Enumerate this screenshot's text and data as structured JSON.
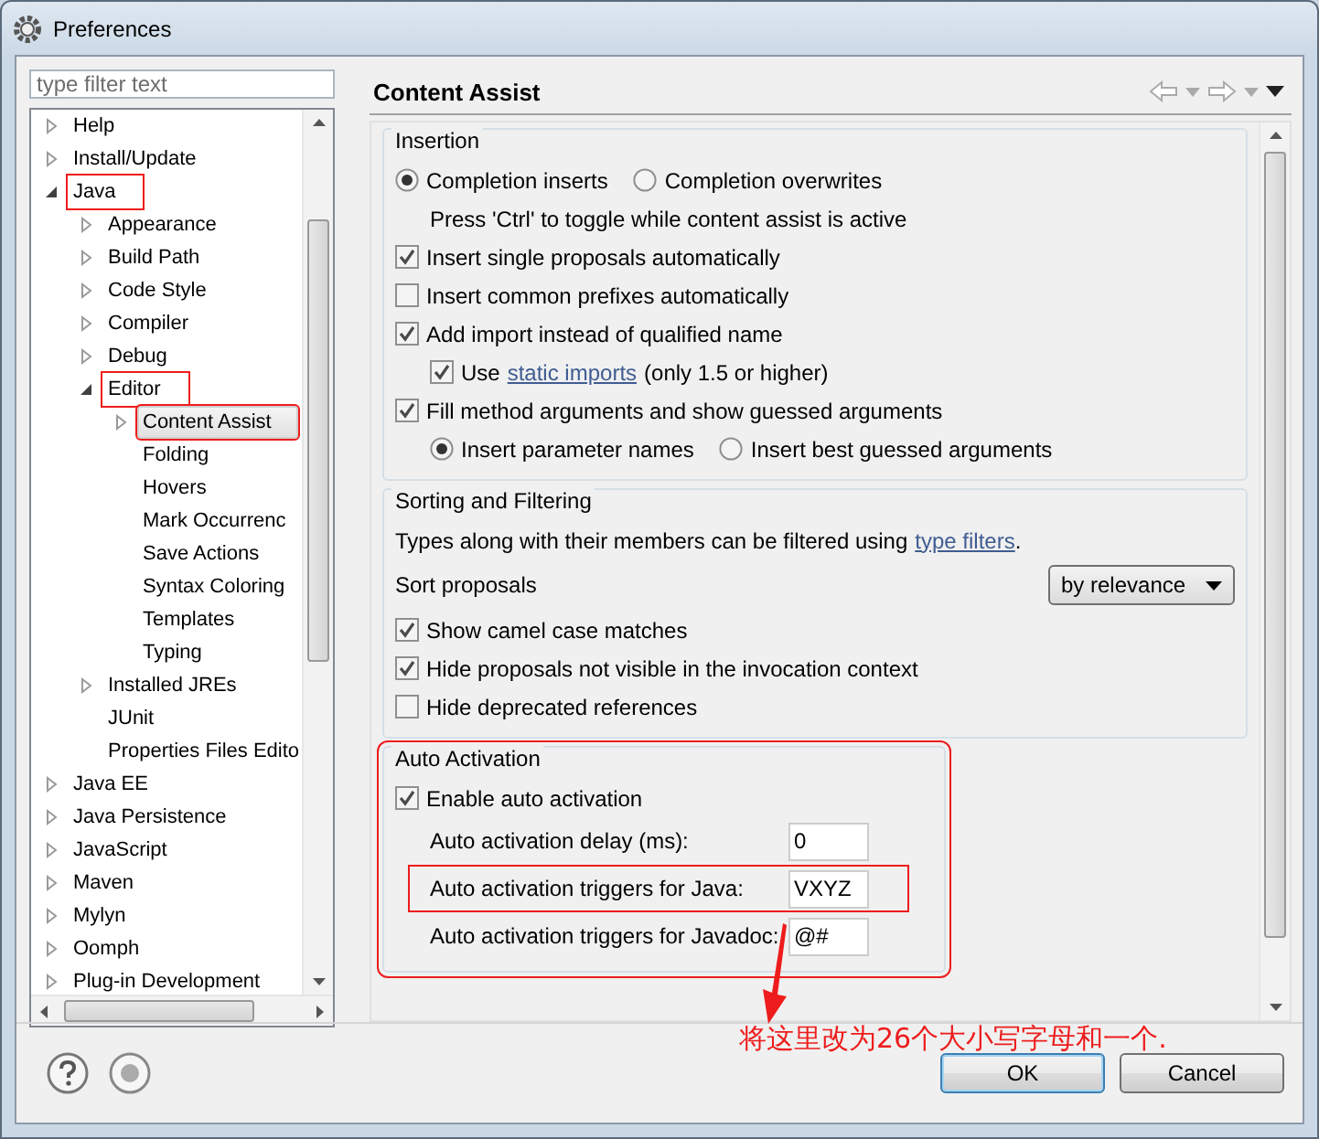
{
  "window": {
    "title": "Preferences"
  },
  "filter": {
    "placeholder": "type filter text"
  },
  "tree": [
    {
      "label": "Help",
      "expanded": false,
      "selected": false
    },
    {
      "label": "Install/Update",
      "expanded": false,
      "selected": false
    },
    {
      "label": "Java",
      "expanded": true,
      "selected": false,
      "annotated": true,
      "children": [
        {
          "label": "Appearance",
          "expanded": false,
          "selected": false
        },
        {
          "label": "Build Path",
          "expanded": false,
          "selected": false
        },
        {
          "label": "Code Style",
          "expanded": false,
          "selected": false
        },
        {
          "label": "Compiler",
          "expanded": false,
          "selected": false
        },
        {
          "label": "Debug",
          "expanded": false,
          "selected": false
        },
        {
          "label": "Editor",
          "expanded": true,
          "selected": false,
          "annotated": true,
          "children": [
            {
              "label": "Content Assist",
              "expanded": false,
              "selected": true,
              "annotated": true
            },
            {
              "label": "Folding",
              "selected": false
            },
            {
              "label": "Hovers",
              "selected": false
            },
            {
              "label": "Mark Occurrenc",
              "selected": false
            },
            {
              "label": "Save Actions",
              "selected": false
            },
            {
              "label": "Syntax Coloring",
              "selected": false
            },
            {
              "label": "Templates",
              "selected": false
            },
            {
              "label": "Typing",
              "selected": false
            }
          ]
        },
        {
          "label": "Installed JREs",
          "expanded": false,
          "selected": false
        },
        {
          "label": "JUnit",
          "selected": false
        },
        {
          "label": "Properties Files Edito",
          "selected": false
        }
      ]
    },
    {
      "label": "Java EE",
      "expanded": false,
      "selected": false
    },
    {
      "label": "Java Persistence",
      "expanded": false,
      "selected": false
    },
    {
      "label": "JavaScript",
      "expanded": false,
      "selected": false
    },
    {
      "label": "Maven",
      "expanded": false,
      "selected": false
    },
    {
      "label": "Mylyn",
      "expanded": false,
      "selected": false
    },
    {
      "label": "Oomph",
      "expanded": false,
      "selected": false
    },
    {
      "label": "Plug-in Development",
      "expanded": false,
      "selected": false
    }
  ],
  "page": {
    "title": "Content Assist"
  },
  "groups": [
    {
      "title": "Insertion",
      "annotated": false,
      "rows": [
        {
          "kind": "radios",
          "options": [
            {
              "label": "Completion inserts",
              "selected": true
            },
            {
              "label": "Completion overwrites",
              "selected": false
            }
          ]
        },
        {
          "kind": "note",
          "text": "Press 'Ctrl' to toggle while content assist is active"
        },
        {
          "kind": "checkbox",
          "label": "Insert single proposals automatically",
          "checked": true
        },
        {
          "kind": "checkbox",
          "label": "Insert common prefixes automatically",
          "checked": false
        },
        {
          "kind": "checkbox",
          "label": "Add import instead of qualified name",
          "checked": true,
          "children": [
            {
              "kind": "checkbox",
              "label": "Use",
              "link": "static imports",
              "suffix": "(only 1.5 or higher)",
              "checked": true
            }
          ]
        },
        {
          "kind": "checkbox",
          "label": "Fill method arguments and show guessed arguments",
          "checked": true,
          "children": [
            {
              "kind": "radios",
              "options": [
                {
                  "label": "Insert parameter names",
                  "selected": true
                },
                {
                  "label": "Insert best guessed arguments",
                  "selected": false
                }
              ]
            }
          ]
        }
      ]
    },
    {
      "title": "Sorting and Filtering",
      "annotated": false,
      "rows": [
        {
          "kind": "text",
          "text": "Types along with their members can be filtered using",
          "link": "type filters",
          "suffix": "."
        },
        {
          "kind": "select",
          "label": "Sort proposals",
          "value": "by relevance"
        },
        {
          "kind": "checkbox",
          "label": "Show camel case matches",
          "checked": true
        },
        {
          "kind": "checkbox",
          "label": "Hide proposals not visible in the invocation context",
          "checked": true
        },
        {
          "kind": "checkbox",
          "label": "Hide deprecated references",
          "checked": false
        }
      ]
    },
    {
      "title": "Auto Activation",
      "annotated": true,
      "rows": [
        {
          "kind": "checkbox",
          "label": "Enable auto activation",
          "checked": true,
          "children": [
            {
              "kind": "field",
              "label": "Auto activation delay (ms):",
              "value": "0",
              "annotated": false
            },
            {
              "kind": "field",
              "label": "Auto activation triggers for Java:",
              "value": "VXYZ",
              "annotated": true
            },
            {
              "kind": "field",
              "label": "Auto activation triggers for Javadoc:",
              "value": "@#",
              "annotated": false
            }
          ]
        }
      ]
    }
  ],
  "buttons": [
    {
      "label": "OK",
      "default": true
    },
    {
      "label": "Cancel",
      "default": false
    }
  ],
  "annotation": {
    "text": "将这里改为26个大小写字母和一个."
  }
}
